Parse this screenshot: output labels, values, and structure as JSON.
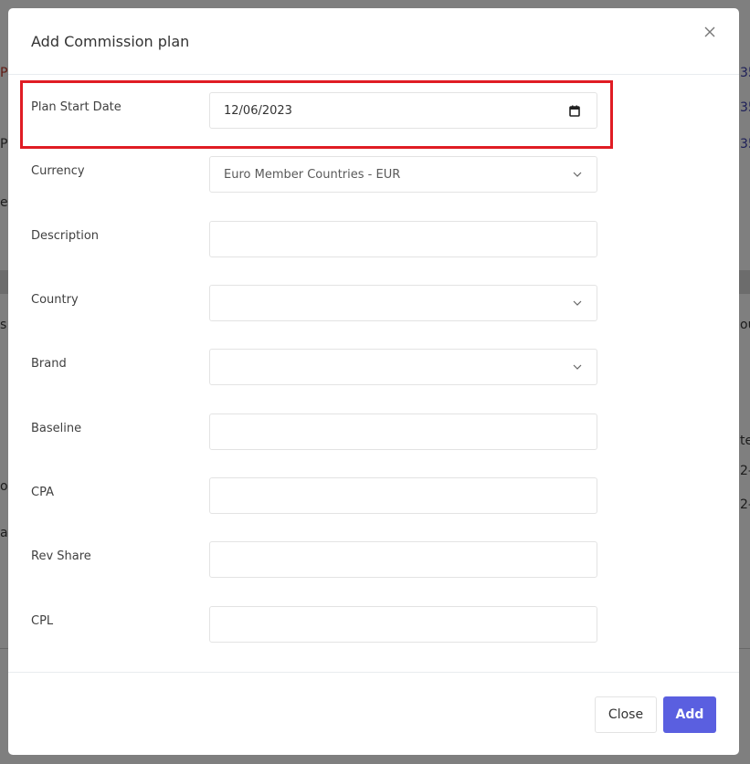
{
  "modal": {
    "title": "Add Commission plan",
    "close_icon": "close-icon"
  },
  "form": {
    "fields": [
      {
        "label": "Plan Start Date",
        "type": "date",
        "value": "12/06/2023",
        "icon": "calendar-icon"
      },
      {
        "label": "Currency",
        "type": "select",
        "value": "Euro Member Countries - EUR",
        "icon": "chevron-down-icon"
      },
      {
        "label": "Description",
        "type": "text",
        "value": ""
      },
      {
        "label": "Country",
        "type": "select",
        "value": "",
        "icon": "chevron-down-icon"
      },
      {
        "label": "Brand",
        "type": "select",
        "value": "",
        "icon": "chevron-down-icon"
      },
      {
        "label": "Baseline",
        "type": "text",
        "value": ""
      },
      {
        "label": "CPA",
        "type": "text",
        "value": ""
      },
      {
        "label": "Rev Share",
        "type": "text",
        "value": ""
      },
      {
        "label": "CPL",
        "type": "text",
        "value": ""
      }
    ]
  },
  "footer": {
    "close_label": "Close",
    "add_label": "Add"
  },
  "colors": {
    "primary": "#5a5fe0",
    "highlight": "#e01c24",
    "backdrop": "#7a7a7a"
  }
}
